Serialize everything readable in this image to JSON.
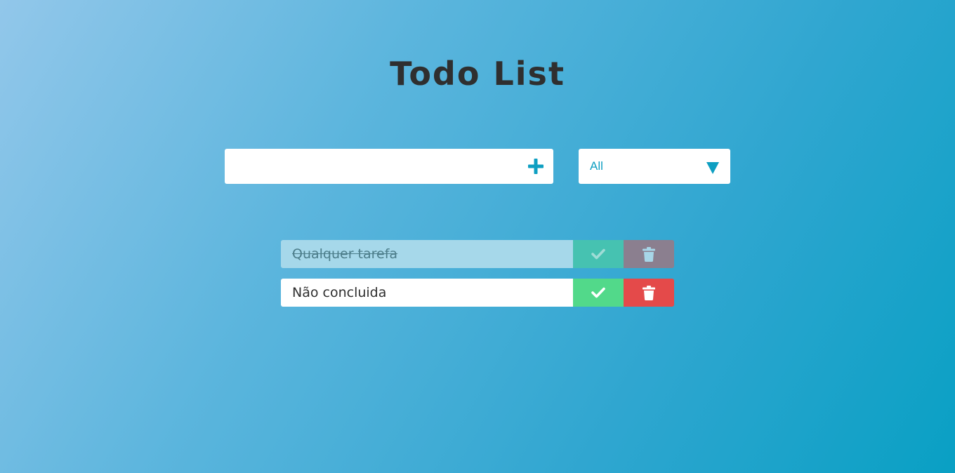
{
  "header": {
    "title": "Todo List"
  },
  "form": {
    "input_value": "",
    "input_placeholder": "",
    "add_icon": "plus-icon"
  },
  "filter": {
    "selected": "All",
    "arrow_icon": "caret-down-icon"
  },
  "todos": [
    {
      "text": "Qualquer tarefa",
      "completed": true
    },
    {
      "text": "Não concluida",
      "completed": false
    }
  ],
  "colors": {
    "accent": "#0e9fc2",
    "check": "#52d98a",
    "trash": "#e44a4a",
    "check_completed": "#46c2b1",
    "trash_completed": "#8b7f8f",
    "title": "#2f2f2f"
  }
}
